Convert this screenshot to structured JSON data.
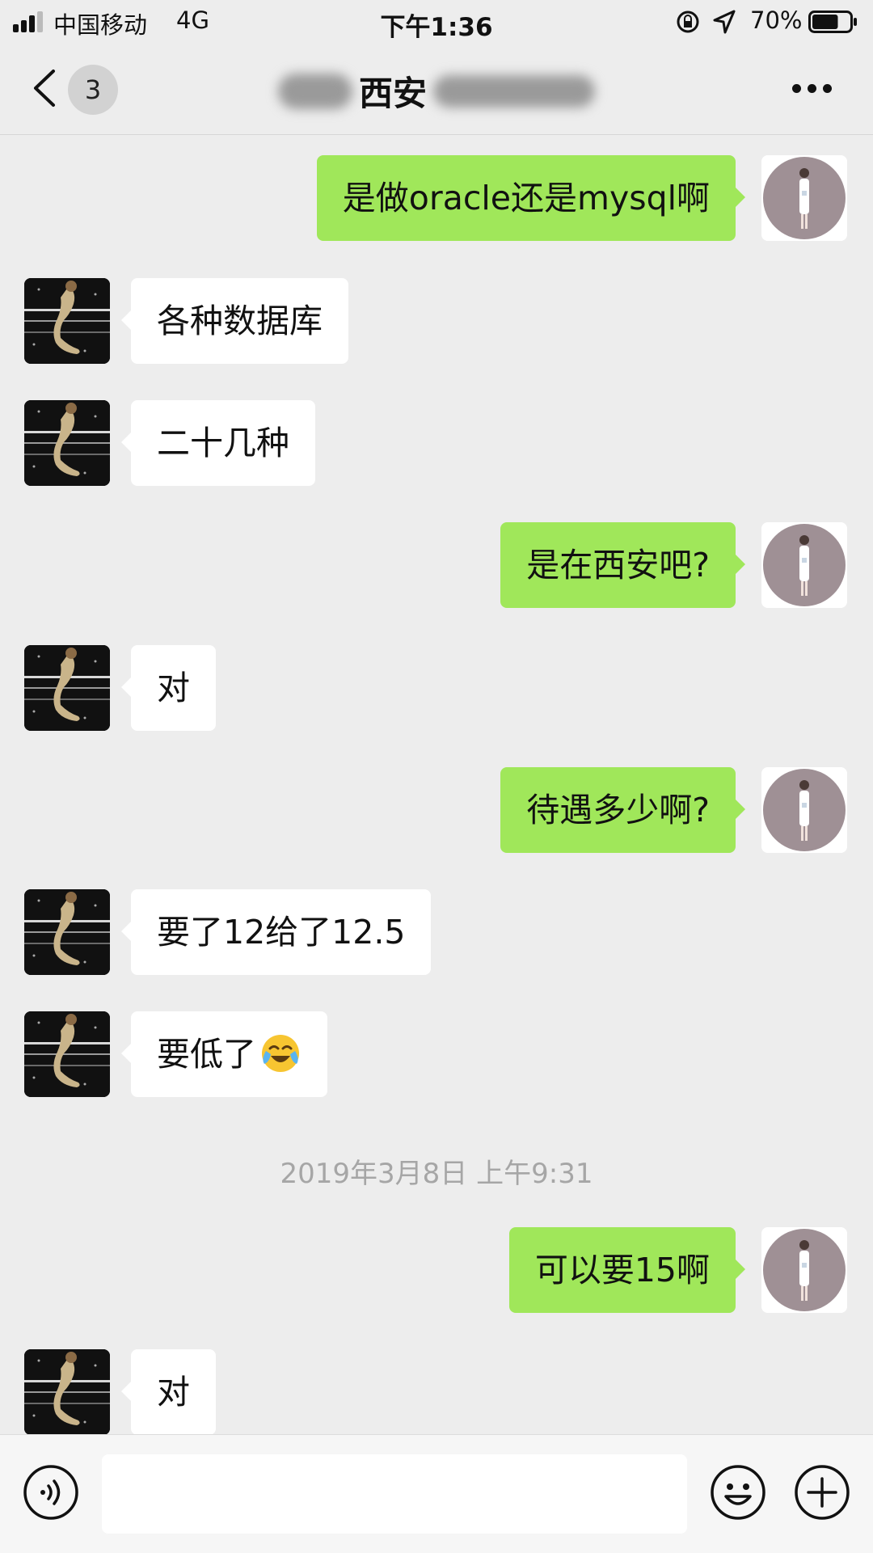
{
  "status_bar": {
    "carrier": "中国移动",
    "network": "4G",
    "time": "下午1:36",
    "battery_percent": "70%",
    "battery_level": 0.7
  },
  "nav": {
    "back_badge": "3",
    "title": "西安"
  },
  "messages": [
    {
      "side": "right",
      "text": "是做oracle还是mysql啊"
    },
    {
      "side": "left",
      "text": "各种数据库"
    },
    {
      "side": "left",
      "text": "二十几种"
    },
    {
      "side": "right",
      "text": "是在西安吧?"
    },
    {
      "side": "left",
      "text": "对"
    },
    {
      "side": "right",
      "text": "待遇多少啊?"
    },
    {
      "side": "left",
      "text": "要了12给了12.5"
    },
    {
      "side": "left",
      "text": "要低了",
      "emoji": "crying-laughing-emoji"
    },
    {
      "side": "right",
      "text": "可以要15啊"
    },
    {
      "side": "left",
      "text": "对"
    }
  ],
  "timestamp": "2019年3月8日 上午9:31",
  "input_bar": {
    "placeholder": "",
    "icons": [
      "voice-icon",
      "emoji-icon",
      "plus-icon"
    ]
  },
  "colors": {
    "background": "#ededed",
    "bubble_self": "#a0e75a",
    "bubble_other": "#ffffff",
    "timestamp": "#a6a6a6"
  }
}
